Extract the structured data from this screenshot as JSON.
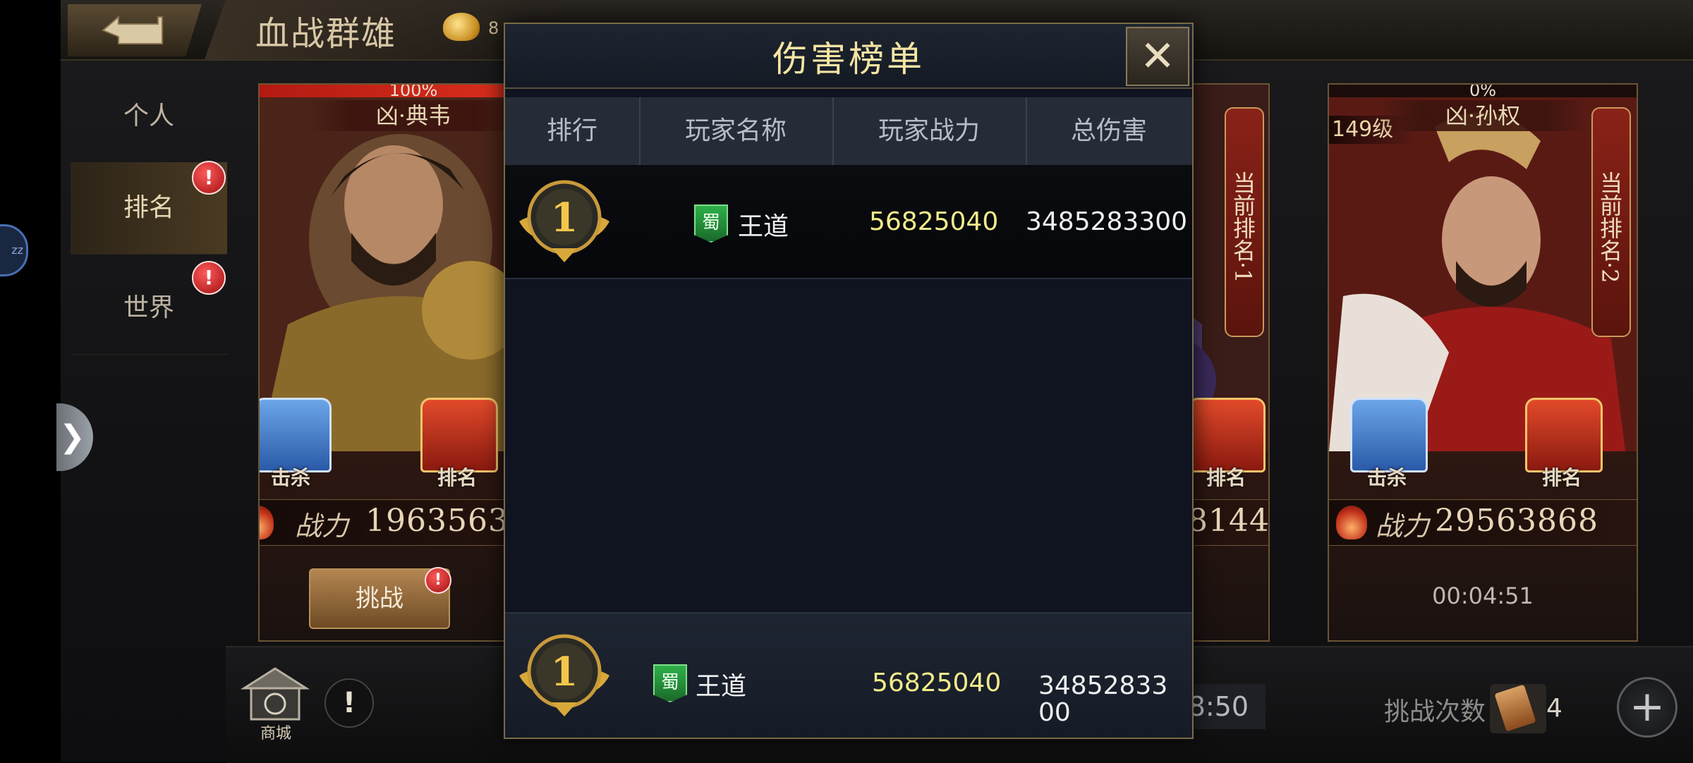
{
  "header": {
    "title": "血战群雄",
    "gold_value": "8"
  },
  "sidebar": {
    "items": [
      {
        "label": "个人"
      },
      {
        "label": "排名",
        "badge": "!"
      },
      {
        "label": "世界",
        "badge": "!"
      }
    ]
  },
  "edge_bubble": "zz",
  "cards": [
    {
      "hp_percent": 100,
      "hp_text": "100%",
      "name": "凶·典韦",
      "kill_label": "击杀",
      "rank_label": "排名",
      "power_label": "战力",
      "power_value": "1963563",
      "challenge_label": "挑战",
      "challenge_badge": "!"
    },
    {
      "rank_text": "当前排名·1",
      "rank_label": "排名",
      "power_value": "8144"
    },
    {
      "hp_percent": 0,
      "hp_text": "0%",
      "level": "149级",
      "name": "凶·孙权",
      "rank_text": "当前排名·2",
      "kill_label": "击杀",
      "rank_label": "排名",
      "power_label": "战力",
      "power_value": "29563868",
      "timer": "00:04:51"
    }
  ],
  "bottom": {
    "shop_label": "商城",
    "alert": "!",
    "timer": "8:50",
    "challenge_count_label": "挑战次数",
    "challenge_count": "4",
    "add": "+"
  },
  "modal": {
    "title": "伤害榜单",
    "close": "✕",
    "columns": [
      "排行",
      "玩家名称",
      "玩家战力",
      "总伤害"
    ],
    "rows": [
      {
        "rank": "1",
        "faction": "蜀",
        "name": "王道",
        "power": "56825040",
        "damage": "3485283300"
      }
    ],
    "my_row": {
      "rank": "1",
      "faction": "蜀",
      "name": "王道",
      "power": "56825040",
      "damage": "3485283300"
    }
  },
  "colors": {
    "title_gold": "#f5e4a4",
    "power_yellow": "#f3ec8a",
    "badge_red": "#d81a1a"
  }
}
